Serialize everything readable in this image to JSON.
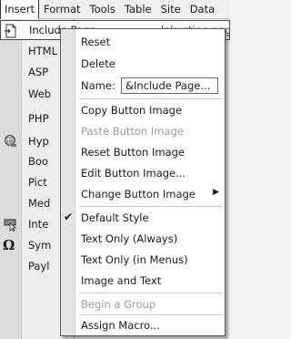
{
  "menubar": {
    "items": [
      "Insert",
      "Format",
      "Tools",
      "Table",
      "Site",
      "Data"
    ]
  },
  "insert_menu": {
    "items": [
      {
        "label": "Include Page...",
        "icon": "include-page-icon"
      },
      {
        "label": "HTML",
        "icon": ""
      },
      {
        "label": "ASP",
        "icon": ""
      },
      {
        "label": "Web",
        "icon": ""
      },
      {
        "label": "PHP",
        "icon": ""
      },
      {
        "label": "Hyp",
        "icon": "hyperlink-globe-icon"
      },
      {
        "label": "Boo",
        "icon": ""
      },
      {
        "label": "Pict",
        "icon": ""
      },
      {
        "label": "Med",
        "icon": ""
      },
      {
        "label": "Inte",
        "icon": "interactive-button-icon"
      },
      {
        "label": "Sym",
        "icon": "omega-symbol-icon"
      },
      {
        "label": "Payl",
        "icon": ""
      }
    ],
    "behind_text": "lakusting page"
  },
  "popup": {
    "reset": "Reset",
    "delete": "Delete",
    "name_label": "Name:",
    "name_value": "&Include Page...",
    "copy_image": "Copy Button Image",
    "paste_image": "Paste Button Image",
    "reset_image": "Reset Button Image",
    "edit_image": "Edit Button Image...",
    "change_image": "Change Button Image",
    "default_style": "Default Style",
    "text_only_always": "Text Only (Always)",
    "text_only_menus": "Text Only (in Menus)",
    "image_and_text": "Image and Text",
    "begin_group": "Begin a Group",
    "assign_macro": "Assign Macro..."
  },
  "colors": {
    "menu_bg": "#ededed",
    "popup_bg": "#ffffff",
    "disabled_text": "#9a9a9a"
  }
}
